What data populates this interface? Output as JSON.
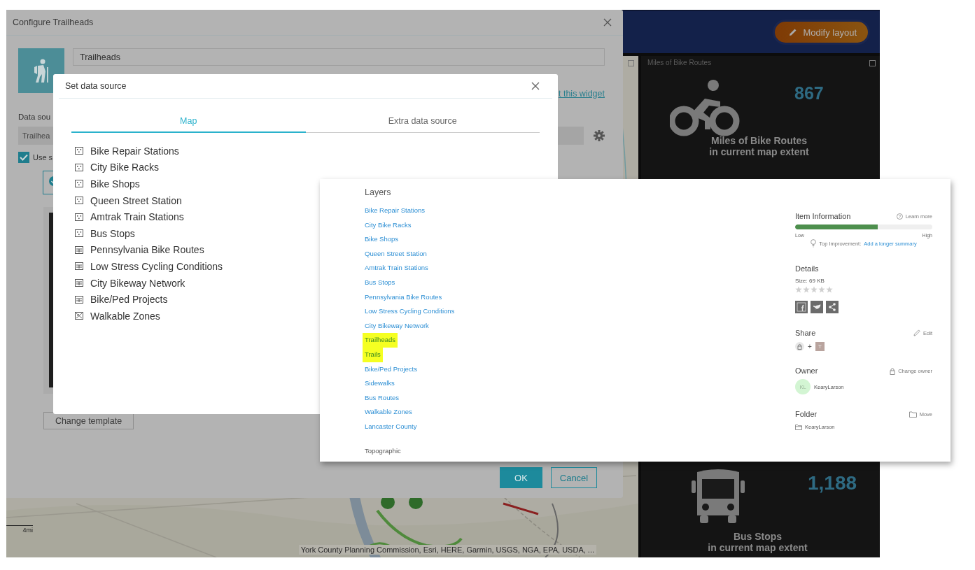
{
  "dashboard": {
    "header_button": "Modify layout",
    "panels": [
      {
        "title": "Miles of Bike Routes",
        "value": "867",
        "caption": [
          "Miles of Bike Routes",
          "in current map extent"
        ]
      },
      {
        "value": "1,188",
        "caption": [
          "Bus Stops",
          "in current map extent"
        ]
      }
    ],
    "map": {
      "scale": "4mi",
      "attribution": "York County Planning Commission, Esri, HERE, Garmin, USGS, NGA, EPA, USDA, ..."
    }
  },
  "configure_dialog": {
    "title": "Configure Trailheads",
    "name_value": "Trailheads",
    "link": "t this widget",
    "data_source_label": "Data sou",
    "data_source_value": "Trailhea",
    "use_selection": {
      "label": "Use s",
      "checked": true
    },
    "change_template": "Change template",
    "buttons": [
      "OK",
      "Cancel"
    ]
  },
  "data_source_dialog": {
    "title": "Set data source",
    "tabs": [
      {
        "label": "Map",
        "selected": true
      },
      {
        "label": "Extra data source",
        "selected": false
      }
    ],
    "layers": [
      {
        "name": "Bike Repair Stations",
        "kind": "point"
      },
      {
        "name": "City Bike Racks",
        "kind": "point"
      },
      {
        "name": "Bike Shops",
        "kind": "point"
      },
      {
        "name": "Queen Street Station",
        "kind": "point"
      },
      {
        "name": "Amtrak Train Stations",
        "kind": "point"
      },
      {
        "name": "Bus Stops",
        "kind": "point"
      },
      {
        "name": "Pennsylvania Bike Routes",
        "kind": "line"
      },
      {
        "name": "Low Stress Cycling Conditions",
        "kind": "line"
      },
      {
        "name": "City Bikeway Network",
        "kind": "line"
      },
      {
        "name": "Bike/Ped Projects",
        "kind": "line"
      },
      {
        "name": "Walkable Zones",
        "kind": "polygon"
      }
    ]
  },
  "item_page": {
    "layers_heading": "Layers",
    "layers": [
      {
        "name": "Bike Repair Stations",
        "highlighted": false
      },
      {
        "name": "City Bike Racks",
        "highlighted": false
      },
      {
        "name": "Bike Shops",
        "highlighted": false
      },
      {
        "name": "Queen Street Station",
        "highlighted": false
      },
      {
        "name": "Amtrak Train Stations",
        "highlighted": false
      },
      {
        "name": "Bus Stops",
        "highlighted": false
      },
      {
        "name": "Pennsylvania Bike Routes",
        "highlighted": false
      },
      {
        "name": "Low Stress Cycling Conditions",
        "highlighted": false
      },
      {
        "name": "City Bikeway Network",
        "highlighted": false
      },
      {
        "name": "Trailheads",
        "highlighted": true
      },
      {
        "name": "Trails",
        "highlighted": true
      },
      {
        "name": "Bike/Ped Projects",
        "highlighted": false
      },
      {
        "name": "Sidewalks",
        "highlighted": false
      },
      {
        "name": "Bus Routes",
        "highlighted": false
      },
      {
        "name": "Walkable Zones",
        "highlighted": false
      },
      {
        "name": "Lancaster County",
        "highlighted": false
      }
    ],
    "basemap": "Topographic",
    "item_information": {
      "title": "Item Information",
      "learn_more": "Learn more",
      "level": 0.6,
      "low": "Low",
      "high": "High",
      "improvement_label": "Top Improvement:",
      "improvement_link": "Add a longer summary"
    },
    "details": {
      "title": "Details",
      "size": "Size: 69 KB",
      "stars": 0
    },
    "share": {
      "title": "Share",
      "edit": "Edit",
      "plus": "+",
      "team_initial": "T"
    },
    "owner": {
      "title": "Owner",
      "action": "Change owner",
      "initials": "KL",
      "name": "KearyLarson"
    },
    "folder": {
      "title": "Folder",
      "action": "Move",
      "name": "KearyLarson"
    }
  }
}
